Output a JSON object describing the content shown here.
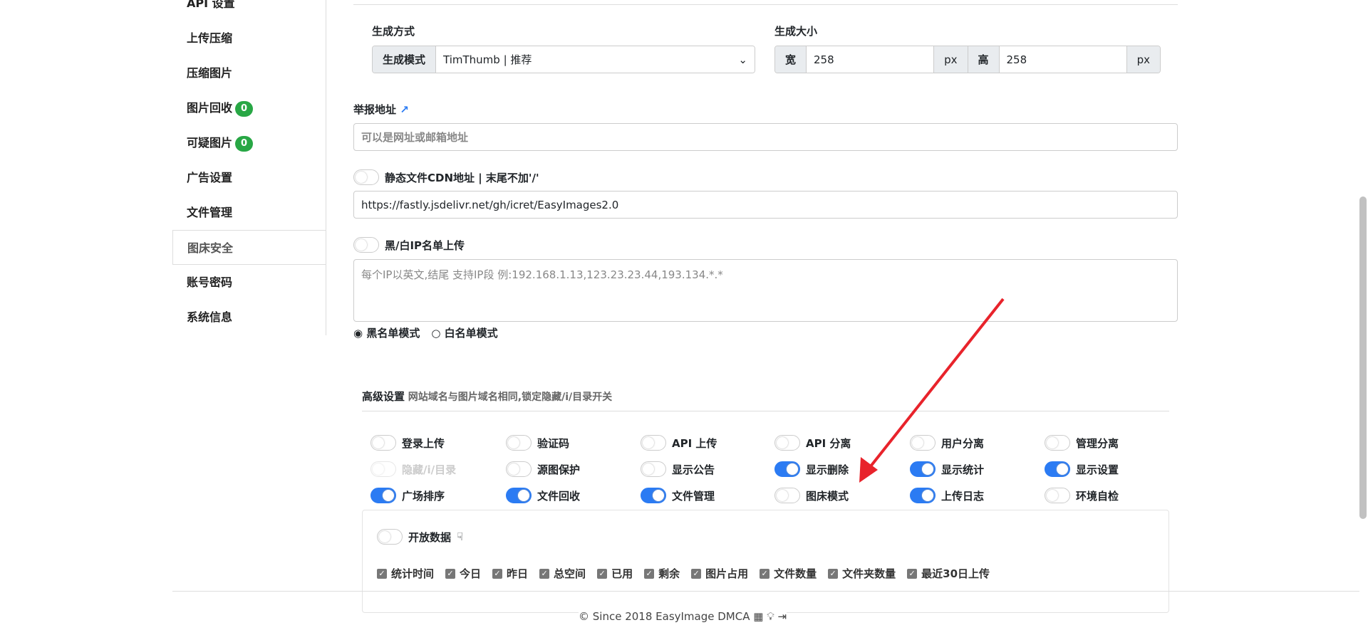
{
  "sidebar": {
    "items": [
      {
        "label": "API 设置"
      },
      {
        "label": "上传压缩"
      },
      {
        "label": "压缩图片"
      },
      {
        "label": "图片回收",
        "badge": "0"
      },
      {
        "label": "可疑图片",
        "badge": "0"
      },
      {
        "label": "广告设置"
      },
      {
        "label": "文件管理"
      },
      {
        "label": "图床安全",
        "active": true
      },
      {
        "label": "账号密码"
      },
      {
        "label": "系统信息"
      }
    ]
  },
  "thumb": {
    "method_label": "生成方式",
    "mode_addon": "生成模式",
    "mode_value": "TimThumb | 推荐",
    "size_label": "生成大小",
    "width_addon": "宽",
    "width_value": "258",
    "height_addon": "高",
    "height_value": "258",
    "unit": "px"
  },
  "report": {
    "label": "举报地址",
    "placeholder": "可以是网址或邮箱地址"
  },
  "cdn": {
    "label": "静态文件CDN地址 | 末尾不加'/'",
    "value": "https://fastly.jsdelivr.net/gh/icret/EasyImages2.0",
    "enabled": false
  },
  "ip": {
    "label": "黑/白IP名单上传",
    "placeholder": "每个IP以英文,结尾 支持IP段 例:192.168.1.13,123.23.23.44,193.134.*.*",
    "enabled": false,
    "black_label": "黑名单模式",
    "white_label": "白名单模式",
    "selected": "black"
  },
  "advanced": {
    "title": "高级设置",
    "note": "网站域名与图片域名相同,锁定隐藏/i/目录开关",
    "switches": [
      {
        "label": "登录上传",
        "on": false
      },
      {
        "label": "验证码",
        "on": false
      },
      {
        "label": "API 上传",
        "on": false
      },
      {
        "label": "API 分离",
        "on": false
      },
      {
        "label": "用户分离",
        "on": false
      },
      {
        "label": "管理分离",
        "on": false
      },
      {
        "label": "隐藏/i/目录",
        "on": false,
        "disabled": true
      },
      {
        "label": "源图保护",
        "on": false
      },
      {
        "label": "显示公告",
        "on": false
      },
      {
        "label": "显示删除",
        "on": true
      },
      {
        "label": "显示统计",
        "on": true
      },
      {
        "label": "显示设置",
        "on": true
      },
      {
        "label": "广场排序",
        "on": true
      },
      {
        "label": "文件回收",
        "on": true
      },
      {
        "label": "文件管理",
        "on": true
      },
      {
        "label": "图床模式",
        "on": false
      },
      {
        "label": "上传日志",
        "on": true
      },
      {
        "label": "环境自检",
        "on": false
      }
    ]
  },
  "open_data": {
    "label": "开放数据",
    "on": false,
    "checks": [
      "统计时间",
      "今日",
      "昨日",
      "总空间",
      "已用",
      "剩余",
      "图片占用",
      "文件数量",
      "文件夹数量",
      "最近30日上传"
    ]
  },
  "footer": {
    "text": "© Since 2018 EasyImage DMCA"
  },
  "colors": {
    "accent": "#2b7bf3",
    "badge": "#28a745",
    "arrow": "#e8232b"
  }
}
